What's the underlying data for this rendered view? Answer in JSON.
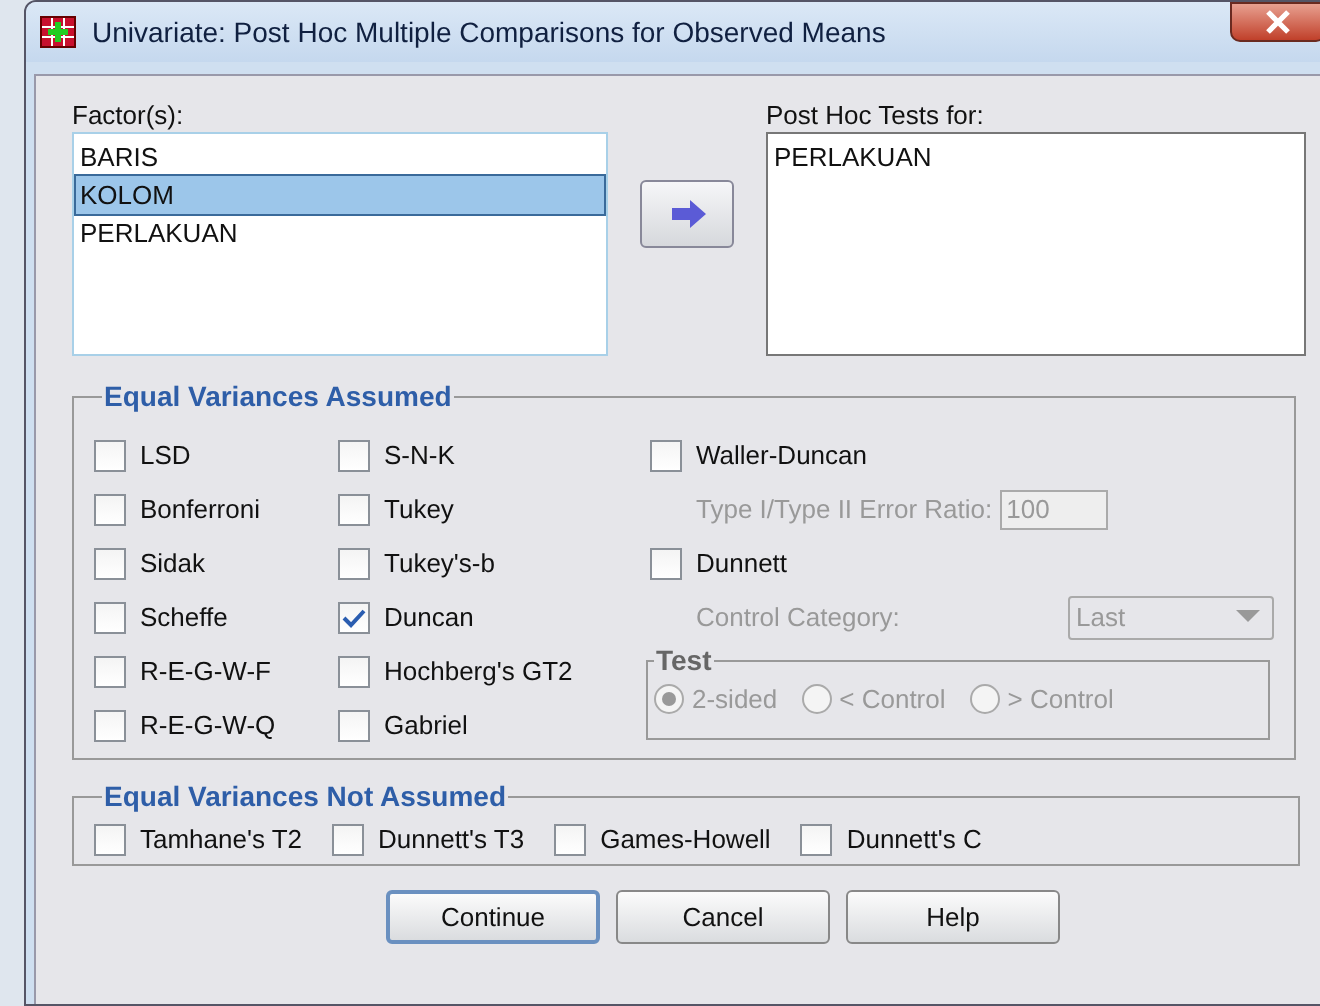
{
  "window": {
    "title": "Univariate: Post Hoc Multiple Comparisons for Observed Means"
  },
  "factors": {
    "label": "Factor(s):",
    "items": [
      {
        "label": "BARIS",
        "selected": false
      },
      {
        "label": "KOLOM",
        "selected": true
      },
      {
        "label": "PERLAKUAN",
        "selected": false
      }
    ]
  },
  "post_hoc_tests_for": {
    "label": "Post Hoc Tests for:",
    "items": [
      "PERLAKUAN"
    ]
  },
  "equal_variances_assumed": {
    "title": "Equal Variances Assumed",
    "column_1": [
      {
        "label": "LSD",
        "checked": false
      },
      {
        "label": "Bonferroni",
        "checked": false
      },
      {
        "label": "Sidak",
        "checked": false
      },
      {
        "label": "Scheffe",
        "checked": false
      },
      {
        "label": "R-E-G-W-F",
        "checked": false
      },
      {
        "label": "R-E-G-W-Q",
        "checked": false
      }
    ],
    "column_2": [
      {
        "label": "S-N-K",
        "checked": false
      },
      {
        "label": "Tukey",
        "checked": false
      },
      {
        "label": "Tukey's-b",
        "checked": false
      },
      {
        "label": "Duncan",
        "checked": true
      },
      {
        "label": "Hochberg's GT2",
        "checked": false
      },
      {
        "label": "Gabriel",
        "checked": false
      }
    ],
    "waller_duncan": {
      "label": "Waller-Duncan",
      "checked": false
    },
    "error_ratio": {
      "label": "Type I/Type II Error Ratio:",
      "value": "100",
      "disabled": true
    },
    "dunnett": {
      "label": "Dunnett",
      "checked": false
    },
    "control_category": {
      "label": "Control Category:",
      "value": "Last",
      "disabled": true
    },
    "test": {
      "title": "Test",
      "disabled": true,
      "options": [
        {
          "label": "2-sided",
          "selected": true
        },
        {
          "label": "< Control",
          "selected": false
        },
        {
          "label": "> Control",
          "selected": false
        }
      ]
    }
  },
  "equal_variances_not_assumed": {
    "title": "Equal Variances Not Assumed",
    "items": [
      {
        "label": "Tamhane's T2",
        "checked": false
      },
      {
        "label": "Dunnett's T3",
        "checked": false
      },
      {
        "label": "Games-Howell",
        "checked": false
      },
      {
        "label": "Dunnett's C",
        "checked": false
      }
    ]
  },
  "buttons": [
    {
      "label": "Continue",
      "default": true
    },
    {
      "label": "Cancel",
      "default": false
    },
    {
      "label": "Help",
      "default": false
    }
  ]
}
